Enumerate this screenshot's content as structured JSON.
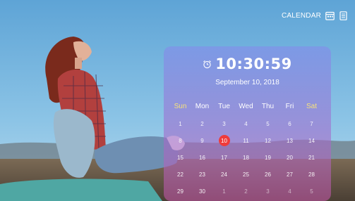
{
  "header": {
    "calendar_label": "CALENDAR",
    "icons": [
      "calendar-grid-icon",
      "rotate-icon"
    ]
  },
  "clock": {
    "time": "10:30:59",
    "date": "September 10, 2018",
    "alarm_icon": "alarm-icon"
  },
  "calendar": {
    "weekdays": [
      "Sun",
      "Mon",
      "Tue",
      "Wed",
      "Thu",
      "Fri",
      "Sat"
    ],
    "weekend_indices": [
      0,
      6
    ],
    "weeks": [
      [
        "1",
        "2",
        "3",
        "4",
        "5",
        "6",
        "7"
      ],
      [
        "8",
        "9",
        "10",
        "11",
        "12",
        "13",
        "14"
      ],
      [
        "15",
        "16",
        "17",
        "18",
        "19",
        "20",
        "21"
      ],
      [
        "22",
        "23",
        "24",
        "25",
        "26",
        "27",
        "28"
      ],
      [
        "29",
        "30",
        "1",
        "2",
        "3",
        "4",
        "5"
      ]
    ],
    "today": "10"
  },
  "colors": {
    "today_highlight": "#ef3b3b",
    "weekend_label": "#f7e27a",
    "panel_top": "#848cea",
    "panel_bottom": "#c456a8"
  }
}
